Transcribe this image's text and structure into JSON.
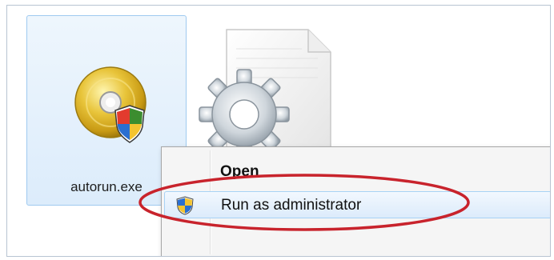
{
  "desktop": {
    "selected_file": {
      "name": "autorun.exe",
      "icon": "disc-setup-shield-icon"
    },
    "other_file": {
      "icon": "settings-file-icon"
    }
  },
  "context_menu": {
    "items": [
      {
        "label": "Open",
        "bold": true
      },
      {
        "label": "Run as administrator",
        "icon": "uac-shield-icon",
        "highlighted": true
      }
    ]
  },
  "annotation": {
    "shape": "ellipse",
    "color": "#c8232c",
    "target": "Run as administrator"
  },
  "colors": {
    "selection_fill": "#dcecfb",
    "selection_border": "#9fcaf0",
    "menu_background": "#f5f5f5",
    "highlight_border": "#a8d2f5"
  }
}
